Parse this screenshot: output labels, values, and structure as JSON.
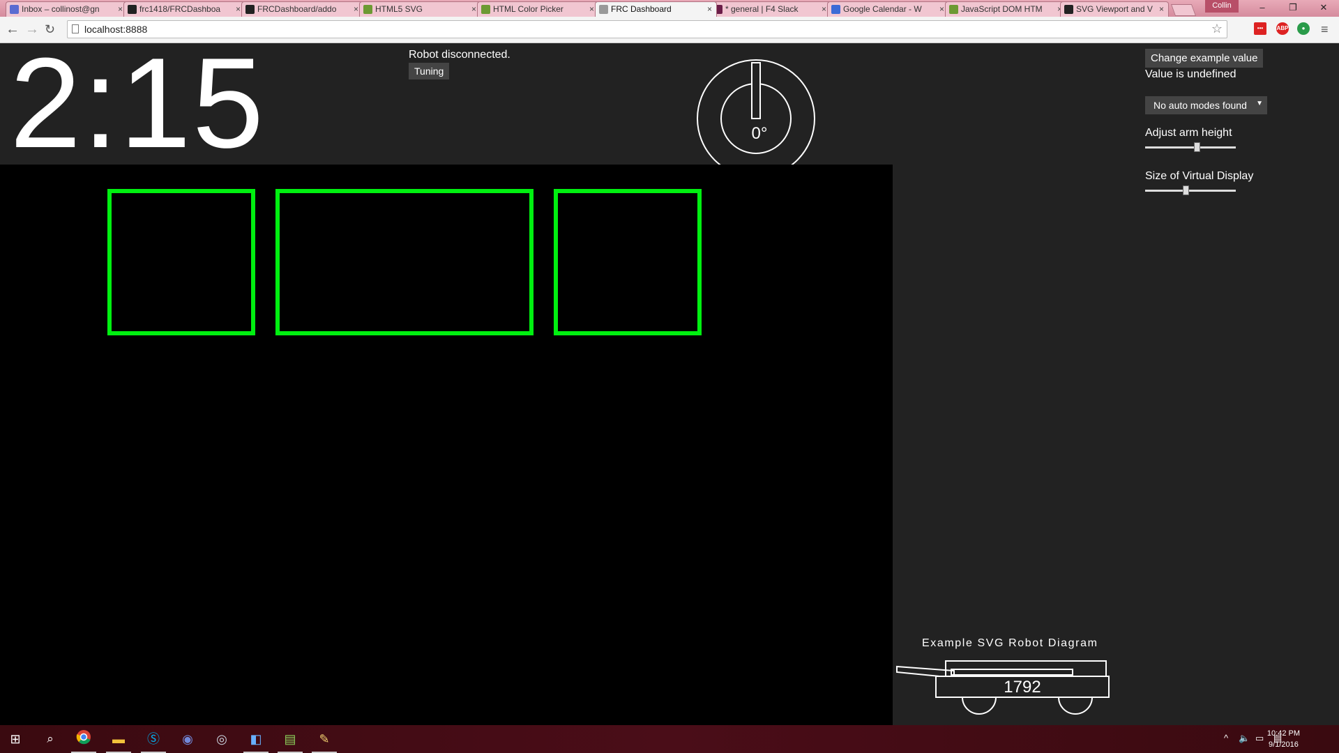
{
  "browser": {
    "tabs": [
      {
        "title": "Inbox – collinost@gn",
        "icon": "gmail-icon",
        "color": "#5b6bd1"
      },
      {
        "title": "frc1418/FRCDashboa",
        "icon": "github-icon",
        "color": "#222222"
      },
      {
        "title": "FRCDashboard/addo",
        "icon": "github-icon",
        "color": "#222222"
      },
      {
        "title": "HTML5 SVG",
        "icon": "w3schools-icon",
        "color": "#6c9a33"
      },
      {
        "title": "HTML Color Picker",
        "icon": "w3schools-icon",
        "color": "#6c9a33"
      },
      {
        "title": "FRC Dashboard",
        "icon": "page-icon",
        "color": "#999999"
      },
      {
        "title": "* general | F4 Slack",
        "icon": "slack-icon",
        "color": "#6b1d48"
      },
      {
        "title": "Google Calendar - W",
        "icon": "calendar-icon",
        "color": "#3b6bd6"
      },
      {
        "title": "JavaScript DOM HTM",
        "icon": "w3schools-icon",
        "color": "#6c9a33"
      },
      {
        "title": "SVG Viewport and V",
        "icon": "jenkov-icon",
        "color": "#222222"
      }
    ],
    "tab_close": "×",
    "user": "Collin",
    "url": "localhost:8888",
    "controls": {
      "minimize": "–",
      "restore": "❐",
      "close": "✕"
    }
  },
  "dashboard": {
    "timer": "2:15",
    "robot_state": "Robot disconnected.",
    "tuning_label": "Tuning",
    "gyro_label": "0°",
    "example_button": "Change example value",
    "value_text": "Value is undefined",
    "auto_select": "No auto modes found",
    "arm_label": "Adjust arm height",
    "arm_value": 0.58,
    "display_label": "Size of Virtual Display",
    "display_value": 0.45,
    "diagram_title": "Example SVG Robot Diagram",
    "team_number": "1792",
    "camera_box_color": "#00f010"
  },
  "taskbar": {
    "time": "10:42 PM",
    "date": "9/1/2016",
    "icons": [
      "windows-start-icon",
      "search-icon",
      "chrome-icon",
      "file-explorer-icon",
      "skype-icon",
      "discord-icon",
      "steam-icon",
      "visual-studio-icon",
      "notepad-icon",
      "paint-icon"
    ]
  }
}
